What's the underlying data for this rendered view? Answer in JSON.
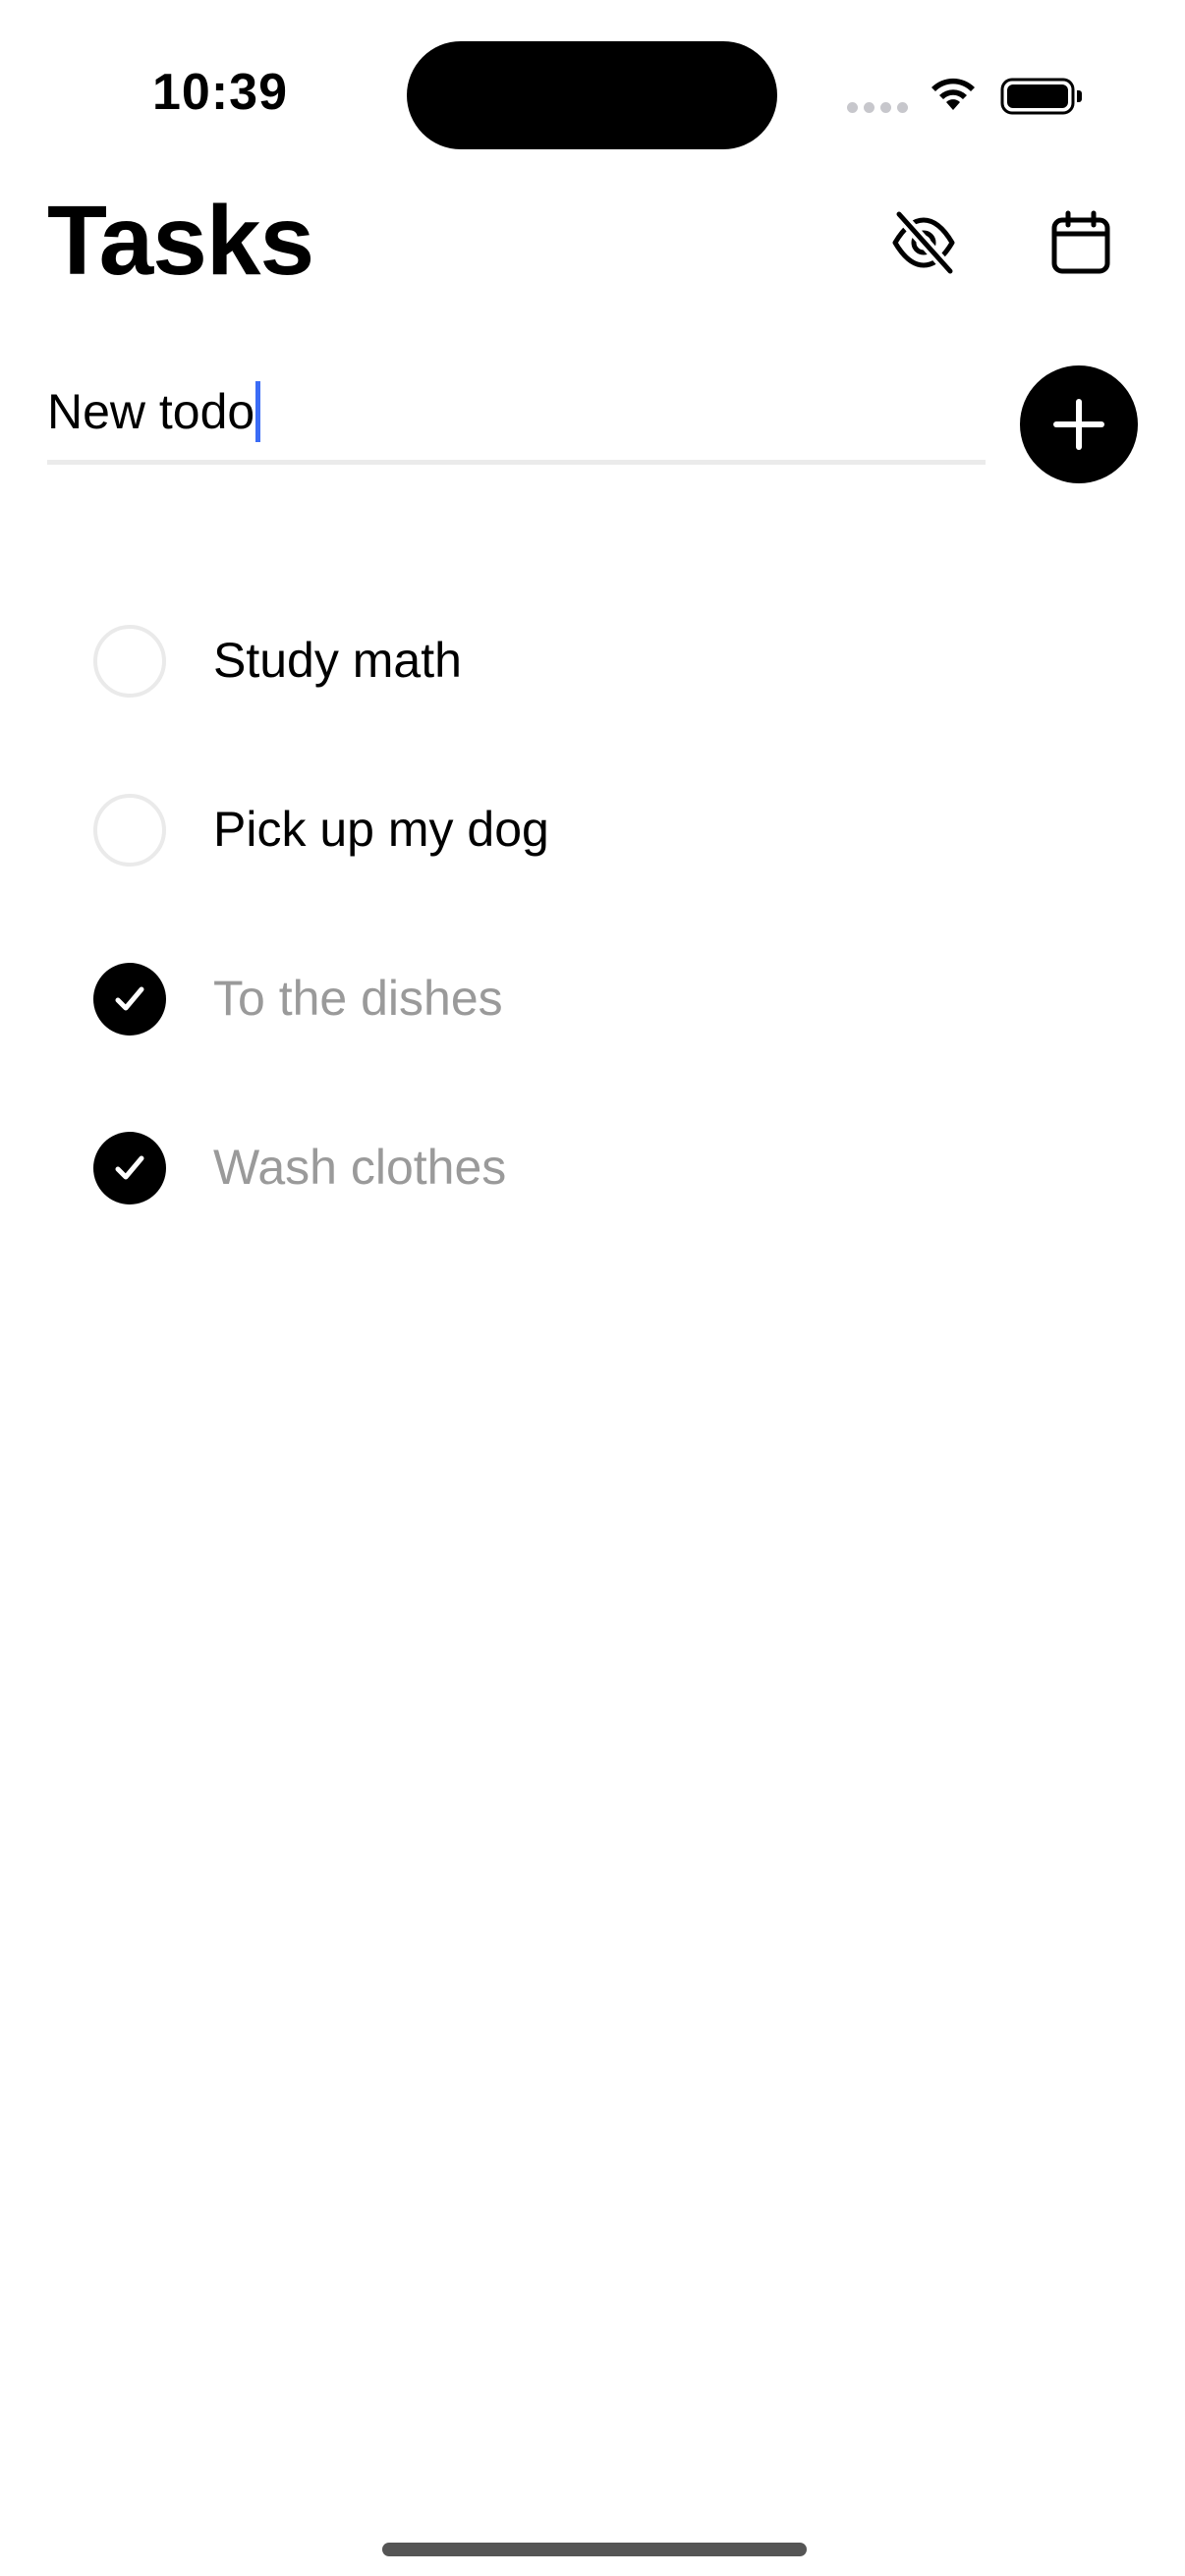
{
  "status_bar": {
    "time": "10:39"
  },
  "header": {
    "title": "Tasks",
    "hide_completed_icon": "eye-slash-icon",
    "calendar_icon": "calendar-icon"
  },
  "new_todo": {
    "value": "New todo",
    "add_icon": "plus-icon"
  },
  "tasks": [
    {
      "label": "Study math",
      "completed": false
    },
    {
      "label": "Pick up my dog",
      "completed": false
    },
    {
      "label": "To the dishes",
      "completed": true
    },
    {
      "label": "Wash clothes",
      "completed": true
    }
  ],
  "colors": {
    "accent": "#000000",
    "caret": "#3b6cf6",
    "completed_text": "#9a9a9a",
    "unchecked_border": "#eaeaea"
  }
}
